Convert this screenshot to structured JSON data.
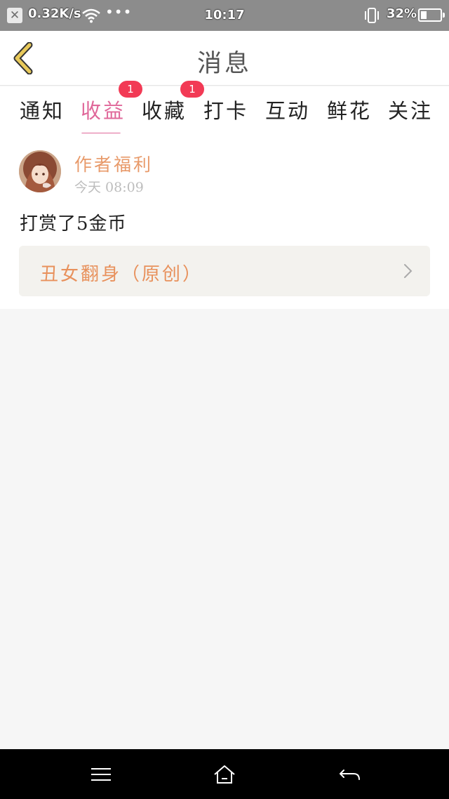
{
  "status_bar": {
    "close_glyph": "✕",
    "net_speed": "0.32K/s",
    "dots": "•••",
    "time": "10:17",
    "battery_percent_text": "32%",
    "battery_level": 0.32
  },
  "header": {
    "title": "消息"
  },
  "tabs": [
    {
      "label": "通知"
    },
    {
      "label": "收益",
      "badge": "1",
      "active": true
    },
    {
      "label": "收藏",
      "badge": "1"
    },
    {
      "label": "打卡"
    },
    {
      "label": "互动"
    },
    {
      "label": "鲜花"
    },
    {
      "label": "关注"
    }
  ],
  "message": {
    "sender": "作者福利",
    "time": "今天 08:09",
    "text": "打赏了5金币",
    "book_title": "丑女翻身（原创）"
  },
  "icons": {
    "back": "chevron-left-icon",
    "link": "chevron-right-icon",
    "menu": "menu-icon",
    "home": "home-icon",
    "return": "back-arrow-icon"
  },
  "colors": {
    "accent": "#e0689a",
    "badge": "#f23a55",
    "sender": "#e89a6a",
    "book_title": "#e8915c",
    "back_icon": "#e8c95a"
  }
}
